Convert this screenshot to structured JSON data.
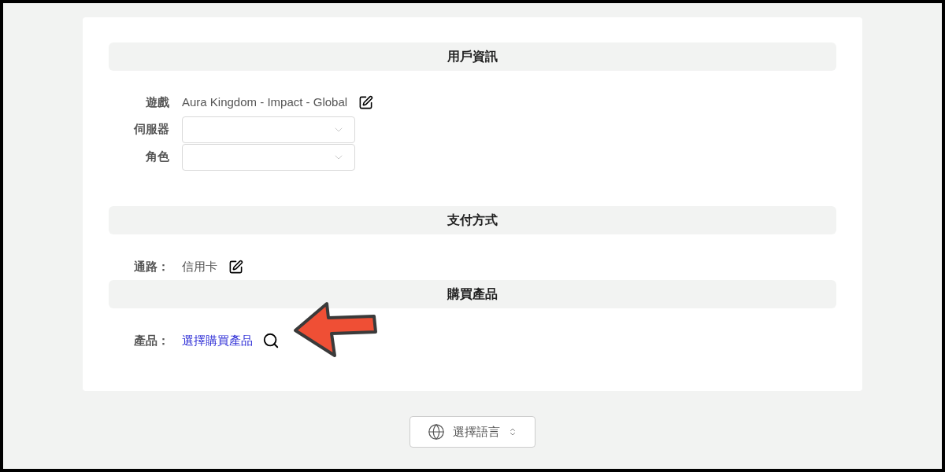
{
  "sections": [
    {
      "title": "用戶資訊",
      "fields": [
        {
          "kind": "text",
          "label": "遊戲",
          "value": "Aura Kingdom - Impact - Global",
          "editable": true
        },
        {
          "kind": "select",
          "label": "伺服器"
        },
        {
          "kind": "select",
          "label": "角色"
        }
      ]
    },
    {
      "title": "支付方式",
      "fields": [
        {
          "kind": "text",
          "label": "通路：",
          "value": "信用卡",
          "editable": true
        }
      ]
    },
    {
      "title": "購買產品",
      "fields": [
        {
          "kind": "link",
          "label": "產品：",
          "value": "選擇購買產品",
          "searchable": true
        }
      ]
    }
  ],
  "language_button": {
    "label": "選擇語言"
  }
}
